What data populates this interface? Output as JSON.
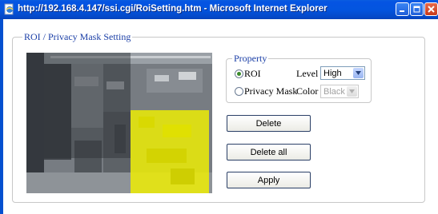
{
  "window": {
    "title": "http://192.168.4.147/ssi.cgi/RoiSetting.htm - Microsoft Internet Explorer",
    "controls": [
      "minimize-icon",
      "maximize-icon",
      "close-icon"
    ]
  },
  "panel": {
    "legend": "ROI / Privacy Mask Setting"
  },
  "property": {
    "legend": "Property",
    "roi_label": "ROI",
    "roi_selected": true,
    "level_label": "Level",
    "level_value": "High",
    "privacy_label": "Privacy Mask",
    "privacy_selected": false,
    "color_label": "Color",
    "color_value": "Black"
  },
  "buttons": {
    "delete": "Delete",
    "delete_all": "Delete all",
    "apply": "Apply"
  },
  "colors": {
    "titlebar": "#0554e3",
    "legend_text": "#1a3ea6",
    "roi_overlay": "#f2f200"
  }
}
